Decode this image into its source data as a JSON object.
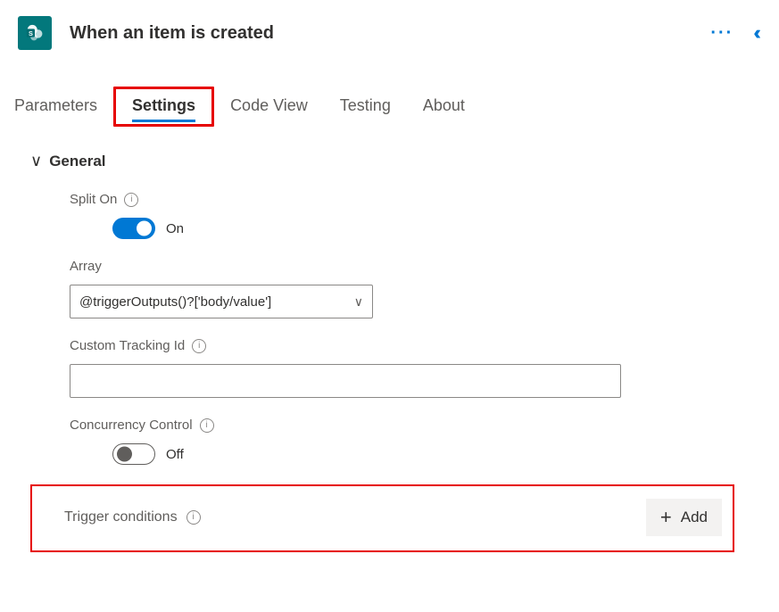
{
  "header": {
    "title": "When an item is created",
    "icon_name": "sharepoint-icon"
  },
  "tabs": [
    {
      "label": "Parameters",
      "active": false
    },
    {
      "label": "Settings",
      "active": true
    },
    {
      "label": "Code View",
      "active": false
    },
    {
      "label": "Testing",
      "active": false
    },
    {
      "label": "About",
      "active": false
    }
  ],
  "section": {
    "title": "General"
  },
  "splitOn": {
    "label": "Split On",
    "state_label": "On",
    "on": true
  },
  "array": {
    "label": "Array",
    "value": "@triggerOutputs()?['body/value']"
  },
  "customTracking": {
    "label": "Custom Tracking Id",
    "value": ""
  },
  "concurrency": {
    "label": "Concurrency Control",
    "state_label": "Off",
    "on": false
  },
  "triggerConditions": {
    "label": "Trigger conditions",
    "add_label": "Add"
  }
}
